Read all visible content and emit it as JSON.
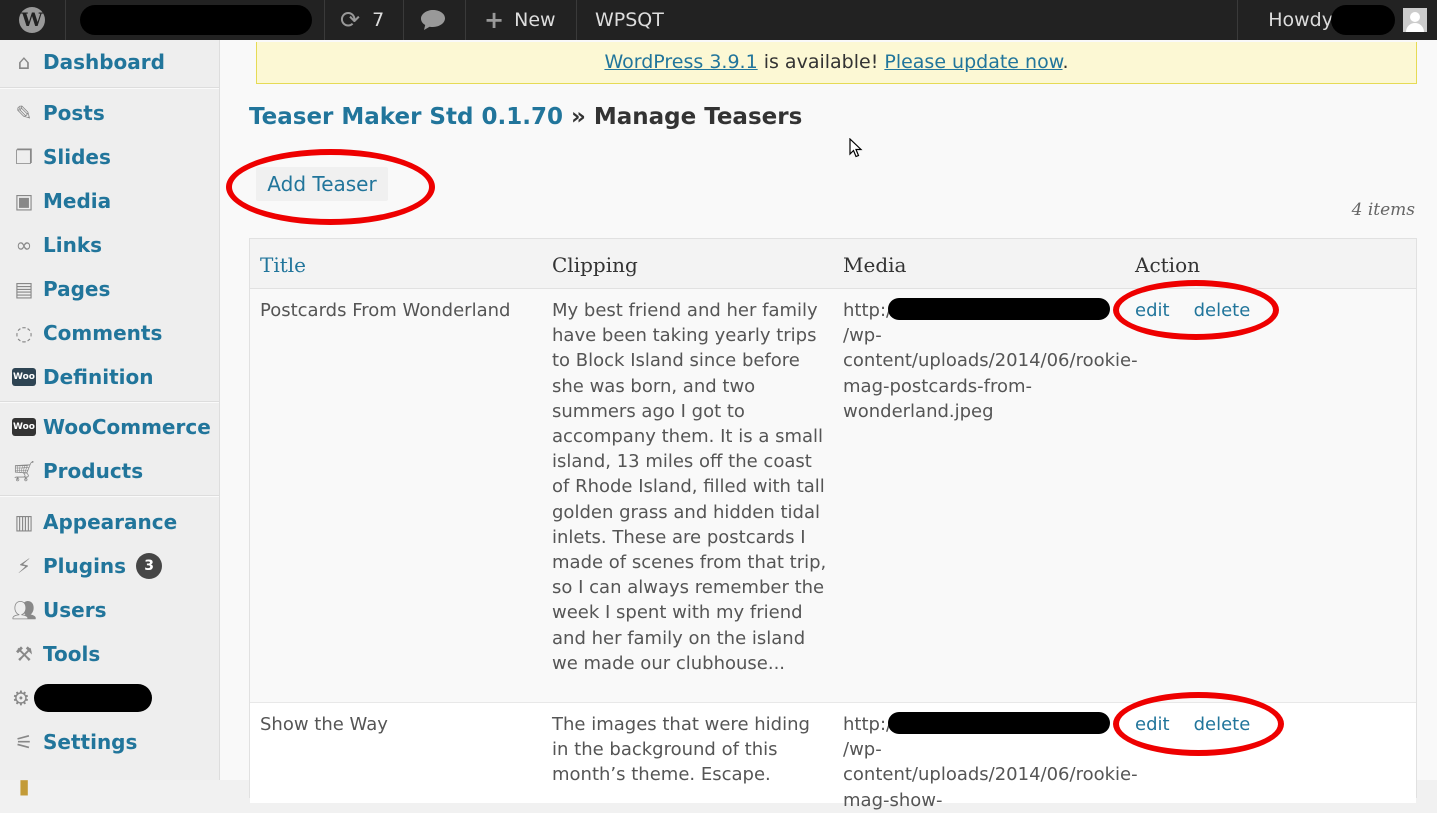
{
  "adminbar": {
    "updates_count": "7",
    "new_label": "New",
    "site_label": "WPSQT",
    "howdy": "Howdy,"
  },
  "sidebar": {
    "items": [
      {
        "label": "Dashboard",
        "icon": "dashboard-icon"
      },
      {
        "label": "Posts",
        "icon": "pin-icon"
      },
      {
        "label": "Slides",
        "icon": "slides-icon"
      },
      {
        "label": "Media",
        "icon": "media-icon"
      },
      {
        "label": "Links",
        "icon": "link-icon"
      },
      {
        "label": "Pages",
        "icon": "pages-icon"
      },
      {
        "label": "Comments",
        "icon": "comment-icon"
      },
      {
        "label": "Definition",
        "icon": "woo-icon"
      },
      {
        "label": "WooCommerce",
        "icon": "woo-icon"
      },
      {
        "label": "Products",
        "icon": "cart-icon"
      },
      {
        "label": "Appearance",
        "icon": "appearance-icon"
      },
      {
        "label": "Plugins",
        "icon": "plugin-icon",
        "badge": "3"
      },
      {
        "label": "Users",
        "icon": "users-icon"
      },
      {
        "label": "Tools",
        "icon": "tools-icon"
      },
      {
        "label": "",
        "icon": "gear-icon"
      },
      {
        "label": "Settings",
        "icon": "settings-icon"
      }
    ]
  },
  "notice": {
    "link1": "WordPress 3.9.1",
    "middle": " is available! ",
    "link2": "Please update now",
    "end": "."
  },
  "page": {
    "plugin_name": "Teaser Maker Std 0.1.70",
    "separator": " » ",
    "title": "Manage Teasers",
    "add_button": "Add Teaser",
    "items_count": "4 items"
  },
  "table": {
    "headers": [
      "Title",
      "Clipping",
      "Media",
      "Action"
    ],
    "rows": [
      {
        "title": "Postcards From Wonderland",
        "clipping": "My best friend and her family have been taking yearly trips to Block Island since before she was born, and two summers ago I got to accompany them. It is a small island, 13 miles off the coast of Rhode Island, filled with tall golden grass and hidden tidal inlets. These are postcards I made of scenes from that trip, so I can always remember the week I spent with my friend and her family on the island we made our clubhouse...",
        "media_prefix": "http:/",
        "media_rest": "/wp-content/uploads/2014/06/rookie-mag-postcards-from-wonderland.jpeg",
        "edit": "edit",
        "delete": "delete"
      },
      {
        "title": "Show the Way",
        "clipping": "The images that were hiding in the background of this month’s theme. Escape.",
        "media_prefix": "http:/",
        "media_rest": "/wp-content/uploads/2014/06/rookie-mag-show-",
        "edit": "edit",
        "delete": "delete"
      }
    ]
  },
  "colors": {
    "link": "#21759b",
    "adminbar": "#222222",
    "annotation": "#ee0000",
    "notice_bg": "#fcf8d4"
  }
}
